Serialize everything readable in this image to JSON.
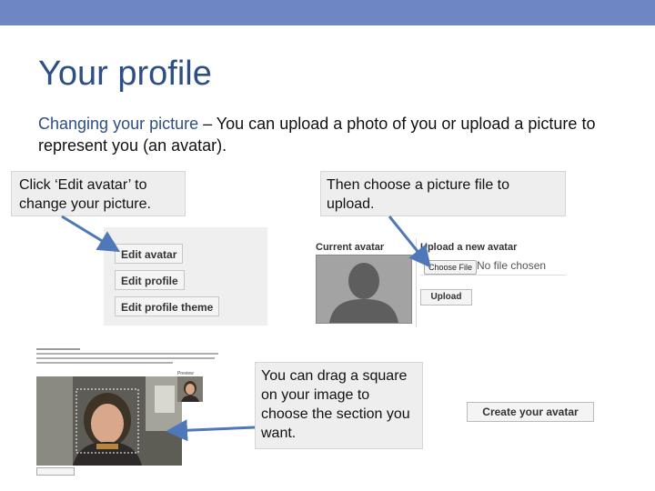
{
  "header": {
    "color": "#6f86c4"
  },
  "slide": {
    "title": "Your profile",
    "intro_highlight": "Changing your picture",
    "intro_rest": " – You can upload a photo of you or upload a picture to represent you (an avatar)."
  },
  "callouts": {
    "edit": "Click ‘Edit avatar’ to change your picture.",
    "choose": "Then choose a picture file to upload.",
    "drag": "You can drag a square on your image to choose the section you want."
  },
  "profile_menu": {
    "edit_avatar": "Edit avatar",
    "edit_profile": "Edit profile",
    "edit_profile_theme": "Edit profile theme"
  },
  "avatar_upload": {
    "current_label": "Current avatar",
    "upload_label": "Upload a new avatar",
    "choose_file": "Choose File",
    "no_file": "No file chosen",
    "upload_button": "Upload"
  },
  "crop_screen": {
    "preview_label": "Preview",
    "create_button": "Create your avatar"
  },
  "colors": {
    "title": "#2d4f86",
    "arrow": "#4e78b8"
  }
}
